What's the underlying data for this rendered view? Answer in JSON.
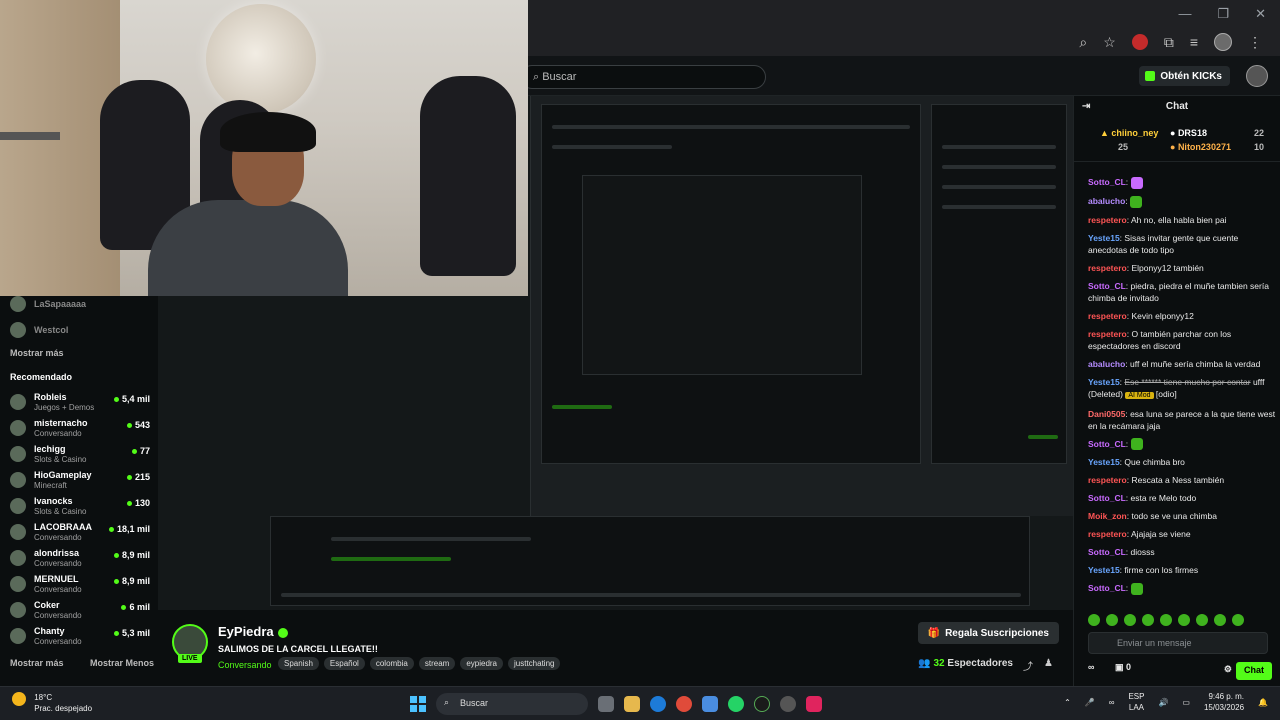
{
  "header": {
    "search_placeholder": "Buscar",
    "kicks_label": "Obtén KICKs"
  },
  "sidebar": {
    "top_items": [
      {
        "name": "LaSapaaaaa"
      },
      {
        "name": "Westcol"
      }
    ],
    "show_more_1": "Mostrar más",
    "recommended_label": "Recomendado",
    "recommended": [
      {
        "name": "Robleis",
        "category": "Juegos + Demos",
        "viewers": "5,4 mil"
      },
      {
        "name": "misternacho",
        "category": "Conversando",
        "viewers": "543"
      },
      {
        "name": "lechigg",
        "category": "Slots & Casino",
        "viewers": "77"
      },
      {
        "name": "HioGameplay",
        "category": "Minecraft",
        "viewers": "215"
      },
      {
        "name": "Ivanocks",
        "category": "Slots & Casino",
        "viewers": "130"
      },
      {
        "name": "LACOBRAAA",
        "category": "Conversando",
        "viewers": "18,1 mil"
      },
      {
        "name": "alondrissa",
        "category": "Conversando",
        "viewers": "8,9 mil"
      },
      {
        "name": "MERNUEL",
        "category": "Conversando",
        "viewers": "8,9 mil"
      },
      {
        "name": "Coker",
        "category": "Conversando",
        "viewers": "6 mil"
      },
      {
        "name": "Chanty",
        "category": "Conversando",
        "viewers": "5,3 mil"
      }
    ],
    "show_more_2": "Mostrar más",
    "show_less": "Mostrar Menos"
  },
  "stream": {
    "streamer": "EyPiedra",
    "live_tag": "LIVE",
    "title": "SALIMOS DE LA CARCEL LLEGATE!!",
    "category": "Conversando",
    "tags": [
      "Spanish",
      "Español",
      "colombia",
      "stream",
      "eypiedra",
      "justtchating"
    ],
    "subs_button": "Regala Suscripciones",
    "viewer_count": "32",
    "viewer_label": "Espectadores"
  },
  "chat": {
    "title": "Chat",
    "gifters": {
      "first": {
        "name": "chiino_ney",
        "count": "25"
      },
      "second": {
        "name": "DRS18",
        "count": "22"
      },
      "third": {
        "name": "Niton230271",
        "count": "10"
      }
    },
    "messages": [
      {
        "user": "Sotto_CL",
        "text": "",
        "color": "#c96bff"
      },
      {
        "user": "abalucho",
        "text": "",
        "color": "#b58cff"
      },
      {
        "user": "respetero",
        "text": "Ah no, ella habla bien pai",
        "color": "#ff5555"
      },
      {
        "user": "Yeste15",
        "text": "Sisas invitar gente que cuente anecdotas de todo tipo",
        "color": "#6aa6ff"
      },
      {
        "user": "respetero",
        "text": "Elponyy12 también",
        "color": "#ff5555"
      },
      {
        "user": "Sotto_CL",
        "text": "piedra, piedra el muñe tambien sería chimba de invitado",
        "color": "#c96bff"
      },
      {
        "user": "respetero",
        "text": "Kevin elponyy12",
        "color": "#ff5555"
      },
      {
        "user": "respetero",
        "text": "O también parchar con los espectadores en discord",
        "color": "#ff5555"
      },
      {
        "user": "abalucho",
        "text": "uff el muñe sería chimba la verdad",
        "color": "#b58cff"
      },
      {
        "user": "Yeste15",
        "text": "Ese ****** tiene mucho por contar",
        "color": "#6aa6ff"
      },
      {
        "user": "Dani0505",
        "text": "esa luna se parece a la que tiene west en la recámara jaja",
        "color": "#ff6a6a"
      },
      {
        "user": "Sotto_CL",
        "text": "",
        "color": "#c96bff"
      },
      {
        "user": "Yeste15",
        "text": "Que chimba bro",
        "color": "#6aa6ff"
      },
      {
        "user": "respetero",
        "text": "Rescata a Ness también",
        "color": "#ff5555"
      },
      {
        "user": "Sotto_CL",
        "text": "esta re Melo todo",
        "color": "#c96bff"
      },
      {
        "user": "Moik_zon",
        "text": "todo se ve una chimba",
        "color": "#ff5555"
      },
      {
        "user": "respetero",
        "text": "Ajajaja se viene",
        "color": "#ff5555"
      },
      {
        "user": "Sotto_CL",
        "text": "diosss",
        "color": "#c96bff"
      },
      {
        "user": "Yeste15",
        "text": "firme con los firmes",
        "color": "#6aa6ff"
      },
      {
        "user": "Sotto_CL",
        "text": "",
        "color": "#c96bff"
      }
    ],
    "deleted_suffix": "ufff (Deleted)",
    "mod_badge": "AI Mod",
    "odio_tag": "[odio]",
    "input_placeholder": "Enviar un mensaje",
    "kicks_count": "0",
    "chat_button": "Chat"
  },
  "taskbar": {
    "temperature": "18°C",
    "weather": "Prac. despejado",
    "search": "Buscar",
    "lang_line1": "ESP",
    "lang_line2": "LAA",
    "time": "9:46 p. m.",
    "date": "15/03/2026"
  },
  "colors": {
    "accent": "#53fc18",
    "background": "#0b0e0f"
  }
}
